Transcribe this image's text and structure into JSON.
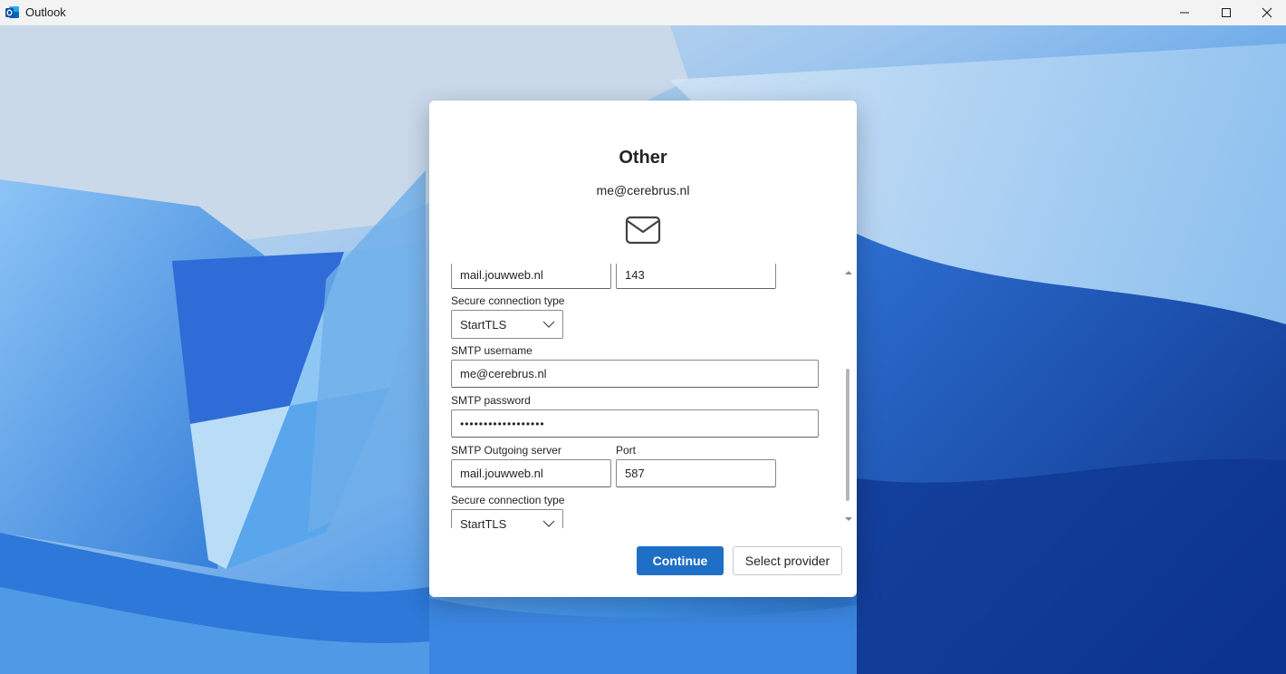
{
  "window": {
    "title": "Outlook",
    "icons": {
      "app": "outlook-logo",
      "minimize": "minimize-icon",
      "maximize": "maximize-icon",
      "close": "close-icon"
    }
  },
  "dialog": {
    "title": "Other",
    "email": "me@cerebrus.nl",
    "icon": "envelope-icon",
    "form": {
      "imap_server_value": "mail.jouwweb.nl",
      "imap_port_value": "143",
      "imap_secure_label": "Secure connection type",
      "imap_secure_value": "StartTLS",
      "smtp_username_label": "SMTP username",
      "smtp_username_value": "me@cerebrus.nl",
      "smtp_password_label": "SMTP password",
      "smtp_password_value": "••••••••••••••••••",
      "smtp_server_label": "SMTP Outgoing server",
      "smtp_server_value": "mail.jouwweb.nl",
      "smtp_port_label": "Port",
      "smtp_port_value": "587",
      "smtp_secure_label": "Secure connection type",
      "smtp_secure_value": "StartTLS"
    },
    "buttons": {
      "continue": "Continue",
      "select_provider": "Select provider"
    }
  },
  "colors": {
    "accent": "#1e6fc5",
    "titlebar": "#f3f3f3",
    "wallpaper_primary": "#2f7fe0"
  }
}
